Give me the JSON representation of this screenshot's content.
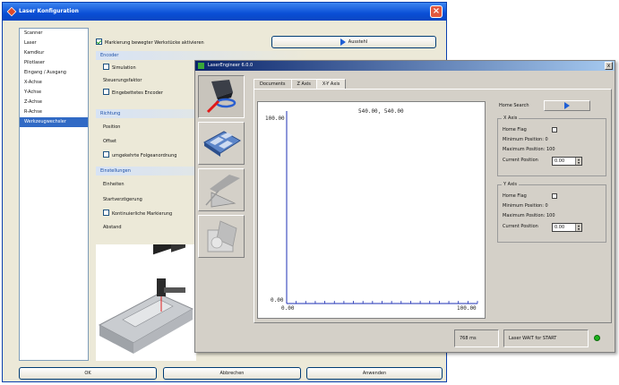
{
  "background_window": {
    "title": "Laser Konfiguration",
    "nav_items": [
      {
        "label": "Scanner",
        "selected": false
      },
      {
        "label": "Laser",
        "selected": false
      },
      {
        "label": "Kamdkur",
        "selected": false
      },
      {
        "label": "Pilotlaser",
        "selected": false
      },
      {
        "label": "Eingang / Ausgang",
        "selected": false
      },
      {
        "label": "X-Achse",
        "selected": false
      },
      {
        "label": "Y-Achse",
        "selected": false
      },
      {
        "label": "Z-Achse",
        "selected": false
      },
      {
        "label": "R-Achse",
        "selected": false
      },
      {
        "label": "Werkzeugwechsler",
        "selected": true
      }
    ],
    "top_checkbox_label": "Markierung bewegter Werkstücke aktivieren",
    "top_button_label": "Ausstehl",
    "groups": {
      "encoder": {
        "title": "Encoder",
        "simulation_label": "Simulation",
        "steuerungsfaktor_label": "Steuerungsfaktor",
        "eingebettet_label": "Eingebettetes Encoder"
      },
      "richtung": {
        "title": "Richtung",
        "position_label": "Position",
        "offset_label": "Offset",
        "umgekehrt_label": "umgekehrte Folgeanordnung"
      },
      "einstellungen": {
        "title": "Einstellungen",
        "einheiten_label": "Einheiten",
        "startverzoegerung_label": "Startverzögerung",
        "kontinuierlich_label": "Kontinuierliche Markierung",
        "abstand_label": "Abstand"
      }
    },
    "buttons": {
      "ok": "OK",
      "abbrechen": "Abbrechen",
      "anwenden": "Anwenden"
    }
  },
  "front_window": {
    "title": "LaserEngineer 6.0.0",
    "close_glyph": "x",
    "tools": [
      {
        "icon": "laser-head-icon"
      },
      {
        "icon": "layout-grid-icon"
      },
      {
        "icon": "beam-prism-icon"
      },
      {
        "icon": "3d-object-icon"
      }
    ],
    "tabs": [
      {
        "label": "Documents",
        "active": false
      },
      {
        "label": "Z Axis",
        "active": false
      },
      {
        "label": "X-Y Axis",
        "active": true
      }
    ],
    "plot": {
      "coord_readout": "540.00, 540.00",
      "y_max_label": "100.00",
      "origin_label": "0.00",
      "x_min_label": "0.00",
      "x_max_label": "100.00"
    },
    "home_search_label": "Home Search",
    "x_axis": {
      "legend": "X Axis",
      "home_flag_label": "Home Flag",
      "minimum_position": "Minimum Position: 0",
      "maximum_position": "Maximum Position: 100",
      "current_position_label": "Current Position",
      "current_position_value": "0.00"
    },
    "y_axis": {
      "legend": "Y Axis",
      "home_flag_label": "Home Flag",
      "minimum_position": "Minimum Position: 0",
      "maximum_position": "Maximum Position: 100",
      "current_position_label": "Current Position",
      "current_position_value": "0.00"
    },
    "status": {
      "time": "768 ms",
      "message": "Laser WAIT for START"
    },
    "status_led_color": "#1db31d"
  }
}
